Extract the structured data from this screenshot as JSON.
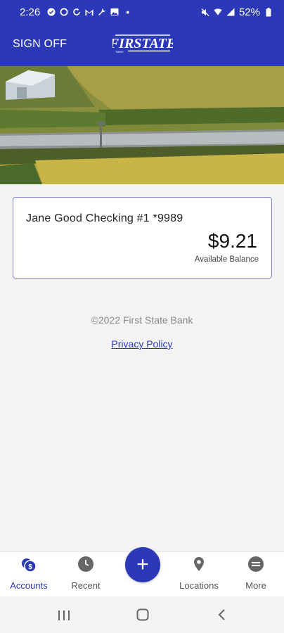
{
  "status_bar": {
    "time": "2:26",
    "battery": "52%",
    "dot": "•"
  },
  "header": {
    "sign_off": "SIGN OFF",
    "logo_text": "FIRSTATE",
    "logo_subtext": "BANK"
  },
  "account": {
    "name": "Jane Good Checking #1 *9989",
    "balance": "$9.21",
    "balance_label": "Available Balance"
  },
  "footer": {
    "copyright": "©2022 First State Bank",
    "privacy": "Privacy Policy"
  },
  "bottom_nav": {
    "items": [
      {
        "label": "Accounts",
        "icon": "accounts-icon",
        "active": true
      },
      {
        "label": "Recent",
        "icon": "clock-icon",
        "active": false
      },
      {
        "label": "Locations",
        "icon": "location-pin-icon",
        "active": false
      },
      {
        "label": "More",
        "icon": "more-icon",
        "active": false
      }
    ],
    "fab_icon": "+"
  },
  "colors": {
    "brand": "#2b38b8",
    "card_border": "#7e85d3",
    "background": "#f3f3f3"
  }
}
